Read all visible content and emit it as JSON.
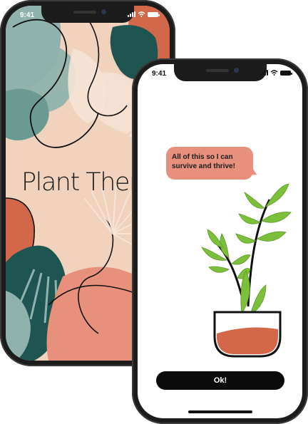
{
  "back_phone": {
    "status": {
      "time": "9:41"
    },
    "title": "Plant Therap"
  },
  "front_phone": {
    "status": {
      "time": "9:41"
    },
    "message": "All of this so I can survive and thrive!",
    "button_label": "Ok!"
  },
  "colors": {
    "peach_background": "#f0d2bd",
    "terracotta": "#d3674a",
    "dark_teal": "#1e5550",
    "sage_teal": "#8fb3ac",
    "salmon": "#e7907c",
    "leaf_green": "#7bbf3a",
    "button_black": "#0b0b0b"
  },
  "icons": [
    "signal-icon",
    "wifi-icon",
    "battery-icon"
  ]
}
